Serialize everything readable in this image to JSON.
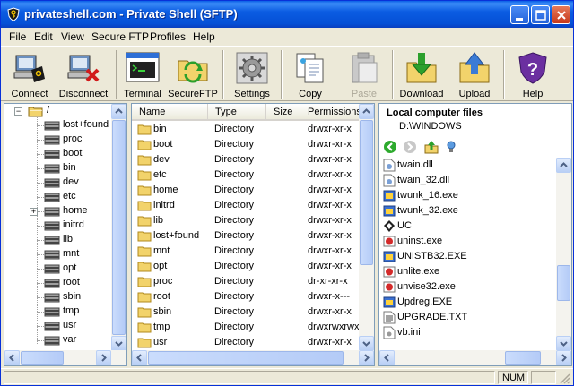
{
  "window": {
    "title": "privateshell.com - Private Shell (SFTP)"
  },
  "menu": [
    "File",
    "Edit",
    "View",
    "Secure FTP",
    "Profiles",
    "Help"
  ],
  "toolbar": {
    "connect": "Connect",
    "disconnect": "Disconnect",
    "terminal": "Terminal",
    "secureftp": "SecureFTP",
    "settings": "Settings",
    "copy": "Copy",
    "paste": "Paste",
    "download": "Download",
    "upload": "Upload",
    "help": "Help"
  },
  "tree": {
    "root": "/",
    "items": [
      "lost+found",
      "proc",
      "boot",
      "bin",
      "dev",
      "etc",
      "home",
      "initrd",
      "lib",
      "mnt",
      "opt",
      "root",
      "sbin",
      "tmp",
      "usr",
      "var"
    ]
  },
  "files": {
    "columns": [
      "Name",
      "Type",
      "Size",
      "Permissions"
    ],
    "rows": [
      {
        "name": "bin",
        "type": "Directory",
        "perm": "drwxr-xr-x"
      },
      {
        "name": "boot",
        "type": "Directory",
        "perm": "drwxr-xr-x"
      },
      {
        "name": "dev",
        "type": "Directory",
        "perm": "drwxr-xr-x"
      },
      {
        "name": "etc",
        "type": "Directory",
        "perm": "drwxr-xr-x"
      },
      {
        "name": "home",
        "type": "Directory",
        "perm": "drwxr-xr-x"
      },
      {
        "name": "initrd",
        "type": "Directory",
        "perm": "drwxr-xr-x"
      },
      {
        "name": "lib",
        "type": "Directory",
        "perm": "drwxr-xr-x"
      },
      {
        "name": "lost+found",
        "type": "Directory",
        "perm": "drwxr-xr-x"
      },
      {
        "name": "mnt",
        "type": "Directory",
        "perm": "drwxr-xr-x"
      },
      {
        "name": "opt",
        "type": "Directory",
        "perm": "drwxr-xr-x"
      },
      {
        "name": "proc",
        "type": "Directory",
        "perm": "dr-xr-xr-x"
      },
      {
        "name": "root",
        "type": "Directory",
        "perm": "drwxr-x---"
      },
      {
        "name": "sbin",
        "type": "Directory",
        "perm": "drwxr-xr-x"
      },
      {
        "name": "tmp",
        "type": "Directory",
        "perm": "drwxrwxrwx"
      },
      {
        "name": "usr",
        "type": "Directory",
        "perm": "drwxr-xr-x"
      }
    ]
  },
  "local": {
    "title": "Local computer files",
    "path": "D:\\WINDOWS",
    "files": [
      "twain.dll",
      "twain_32.dll",
      "twunk_16.exe",
      "twunk_32.exe",
      "UC",
      "uninst.exe",
      "UNISTB32.EXE",
      "unlite.exe",
      "unvise32.exe",
      "Updreg.EXE",
      "UPGRADE.TXT",
      "vb.ini"
    ]
  },
  "status": {
    "num": "NUM"
  }
}
